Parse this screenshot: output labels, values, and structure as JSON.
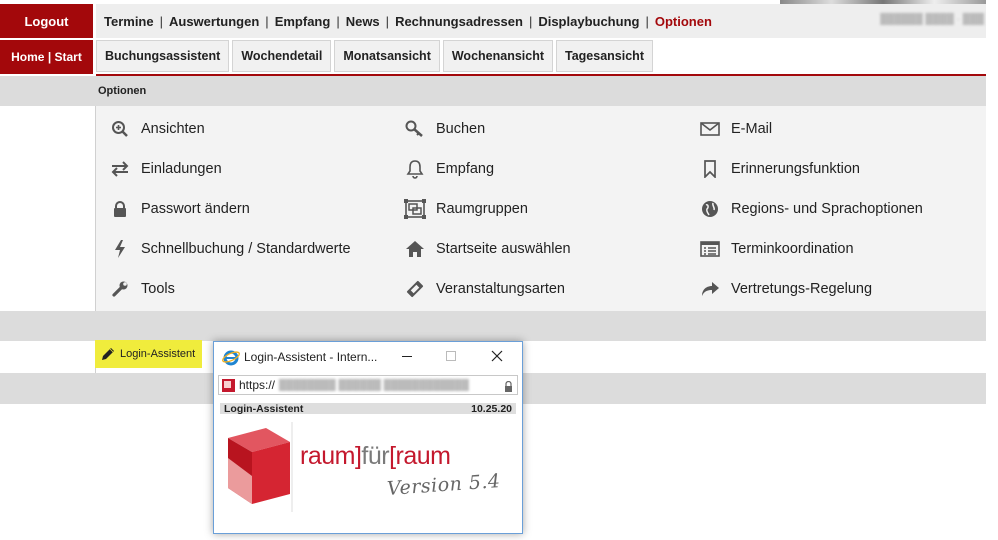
{
  "nav": {
    "logout": "Logout",
    "home": "Home | Start",
    "items": [
      {
        "label": "Termine"
      },
      {
        "label": "Auswertungen"
      },
      {
        "label": "Empfang"
      },
      {
        "label": "News"
      },
      {
        "label": "Rechnungsadressen"
      },
      {
        "label": "Displaybuchung"
      },
      {
        "label": "Optionen"
      }
    ],
    "separator": "|",
    "active_color": "#a3080b"
  },
  "tabs": [
    "Buchungsassistent",
    "Wochendetail",
    "Monatsansicht",
    "Wochenansicht",
    "Tagesansicht"
  ],
  "section_title": "Optionen",
  "options": [
    {
      "label": "Ansichten",
      "icon": "zoom-in-icon"
    },
    {
      "label": "Buchen",
      "icon": "key-icon"
    },
    {
      "label": "E-Mail",
      "icon": "envelope-icon"
    },
    {
      "label": "Einladungen",
      "icon": "exchange-arrows-icon"
    },
    {
      "label": "Empfang",
      "icon": "bell-icon"
    },
    {
      "label": "Erinnerungsfunktion",
      "icon": "bookmark-icon"
    },
    {
      "label": "Passwort ändern",
      "icon": "lock-icon"
    },
    {
      "label": "Raumgruppen",
      "icon": "object-group-icon"
    },
    {
      "label": "Regions- und Sprachoptionen",
      "icon": "globe-icon"
    },
    {
      "label": "Schnellbuchung / Standardwerte",
      "icon": "bolt-icon"
    },
    {
      "label": "Startseite auswählen",
      "icon": "home-icon"
    },
    {
      "label": "Terminkoordination",
      "icon": "list-alt-icon"
    },
    {
      "label": "Tools",
      "icon": "wrench-icon"
    },
    {
      "label": "Veranstaltungsarten",
      "icon": "ticket-icon"
    },
    {
      "label": "Vertretungs-Regelung",
      "icon": "share-arrow-icon"
    }
  ],
  "login_assistant": {
    "label": "Login-Assistent",
    "icon": "pencil-icon"
  },
  "popup": {
    "title": "Login-Assistent - Intern...",
    "url_prefix": "https://",
    "header_left": "Login-Assistent",
    "header_right": "10.25.20",
    "logo_text_a": "raum]",
    "logo_text_b": "für",
    "logo_text_c": "[raum",
    "version": "Version 5.4"
  },
  "colors": {
    "brand": "#a3080b",
    "highlight": "#f0ec3c",
    "logo_red": "#c4182d"
  }
}
